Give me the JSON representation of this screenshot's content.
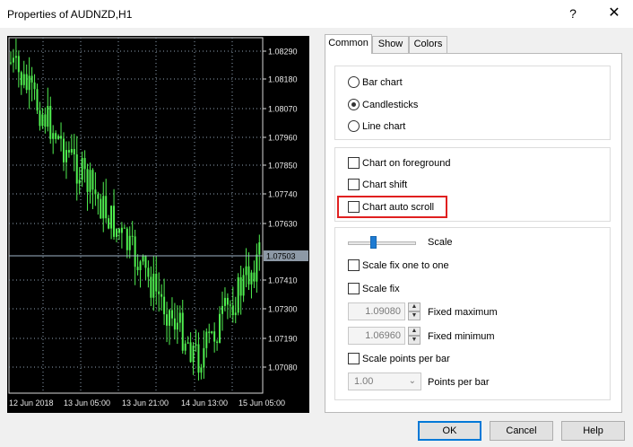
{
  "window": {
    "title": "Properties of AUDNZD,H1",
    "help_glyph": "?",
    "close_glyph": "✕"
  },
  "chart_preview": {
    "price_labels": [
      "1.08290",
      "1.08180",
      "1.08070",
      "1.07960",
      "1.07850",
      "1.07740",
      "1.07630",
      "1.07410",
      "1.07300",
      "1.07190",
      "1.07080"
    ],
    "current_price": "1.07503",
    "time_labels": [
      "12 Jun 2018",
      "13 Jun 05:00",
      "13 Jun 21:00",
      "14 Jun 13:00",
      "15 Jun 05:00"
    ],
    "colors": {
      "background": "#000000",
      "grid": "#8fa2b5",
      "bars": "#50f050",
      "price_line": "#9fb3c8",
      "price_box": "#8d99a6"
    }
  },
  "tabs": [
    {
      "label": "Common",
      "active": true
    },
    {
      "label": "Show",
      "active": false
    },
    {
      "label": "Colors",
      "active": false
    }
  ],
  "chart_type": {
    "options": [
      "Bar chart",
      "Candlesticks",
      "Line chart"
    ],
    "selected": "Candlesticks"
  },
  "options": {
    "chart_on_foreground": {
      "label": "Chart on foreground",
      "checked": false
    },
    "chart_shift": {
      "label": "Chart shift",
      "checked": false
    },
    "chart_auto_scroll": {
      "label": "Chart auto scroll",
      "checked": false,
      "highlight_color": "#e02020"
    }
  },
  "scale": {
    "label": "Scale",
    "scale_fix_one_to_one": {
      "label": "Scale fix one to one",
      "checked": false
    },
    "scale_fix": {
      "label": "Scale fix",
      "checked": false
    },
    "fixed_maximum": {
      "label": "Fixed maximum",
      "value": "1.09080"
    },
    "fixed_minimum": {
      "label": "Fixed minimum",
      "value": "1.06960"
    },
    "scale_points_per_bar": {
      "label": "Scale points per bar",
      "checked": false
    },
    "points_per_bar": {
      "label": "Points per bar",
      "value": "1.00"
    }
  },
  "buttons": {
    "ok": "OK",
    "cancel": "Cancel",
    "help": "Help"
  }
}
